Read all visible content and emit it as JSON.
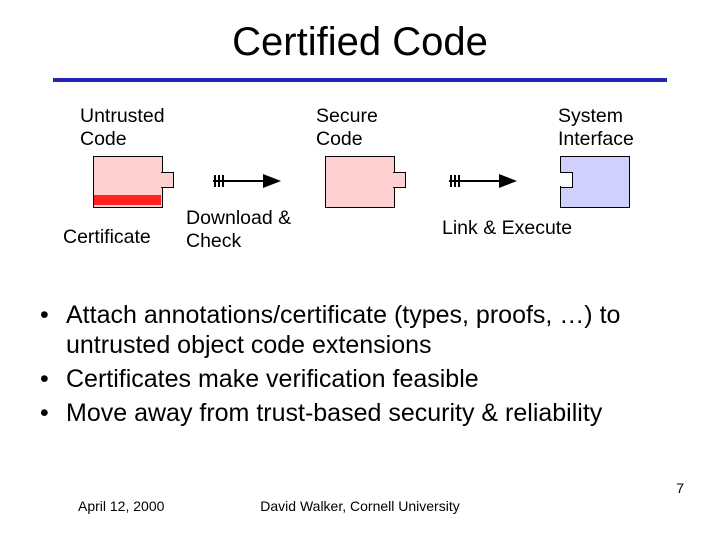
{
  "title": "Certified Code",
  "labels": {
    "untrusted": "Untrusted\nCode",
    "secure": "Secure\nCode",
    "system": "System\nInterface",
    "certificate": "Certificate",
    "download": "Download &\nCheck",
    "link": "Link & Execute"
  },
  "bullets": [
    "Attach annotations/certificate (types, proofs, …) to untrusted object code extensions",
    "Certificates make verification feasible",
    "Move away from trust-based security & reliability"
  ],
  "footer": {
    "date": "April 12, 2000",
    "center": "David Walker, Cornell University",
    "page": "7"
  }
}
